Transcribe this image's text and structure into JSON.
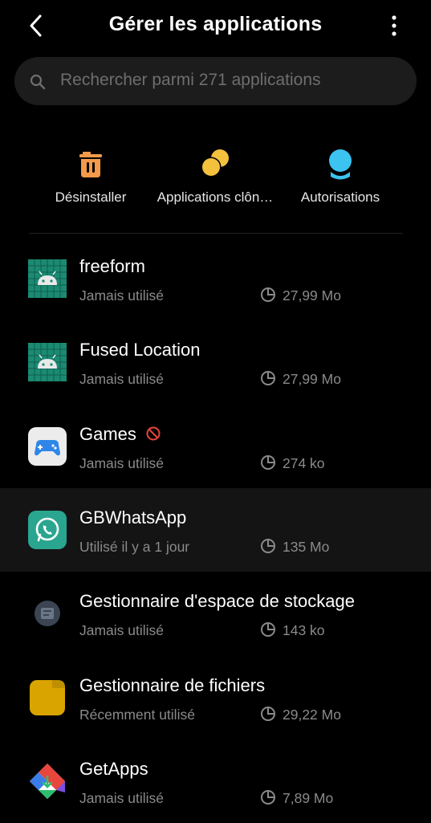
{
  "header": {
    "title": "Gérer les applications"
  },
  "search": {
    "placeholder": "Rechercher parmi 271 applications"
  },
  "quick_actions": [
    {
      "label": "Désinstaller",
      "icon": "trash-icon",
      "color": "#f59a4a"
    },
    {
      "label": "Applications clôn…",
      "icon": "clone-coins-icon",
      "color": "#f4c13d"
    },
    {
      "label": "Autorisations",
      "icon": "permission-badge-icon",
      "color": "#3cc3f0"
    }
  ],
  "apps": [
    {
      "name": "freeform",
      "status": "Jamais utilisé",
      "size": "27,99 Mo",
      "icon": "android-grid-icon"
    },
    {
      "name": "Fused Location",
      "status": "Jamais utilisé",
      "size": "27,99 Mo",
      "icon": "android-grid-icon"
    },
    {
      "name": "Games",
      "status": "Jamais utilisé",
      "size": "274 ko",
      "icon": "gamepad-icon",
      "badge": "ban-icon"
    },
    {
      "name": "GBWhatsApp",
      "status": "Utilisé il y a 1 jour",
      "size": "135 Mo",
      "icon": "whatsapp-icon"
    },
    {
      "name": "Gestionnaire d'espace de stockage",
      "status": "Jamais utilisé",
      "size": "143 ko",
      "icon": "storage-manager-icon"
    },
    {
      "name": "Gestionnaire de fichiers",
      "status": "Récemment utilisé",
      "size": "29,22 Mo",
      "icon": "folder-icon"
    },
    {
      "name": "GetApps",
      "status": "Jamais utilisé",
      "size": "7,89 Mo",
      "icon": "getapps-icon"
    }
  ],
  "colors": {
    "background": "#000000",
    "secondary_text": "#8a8a8a",
    "highlight_row": "#141414"
  }
}
